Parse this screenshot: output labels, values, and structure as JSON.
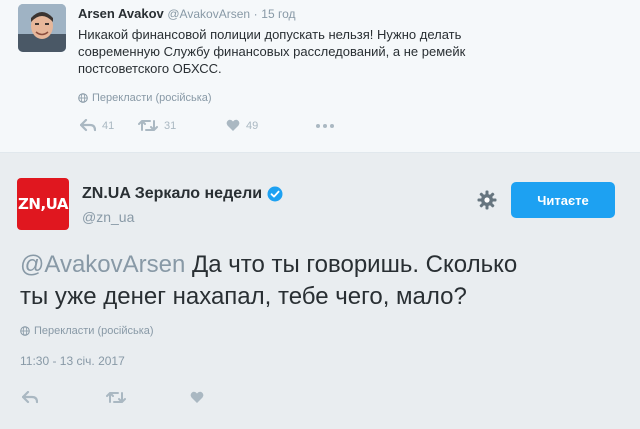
{
  "reply_tweet": {
    "author_name": "Arsen Avakov",
    "handle": "@AvakovArsen",
    "separator": "·",
    "time": "15 год",
    "text_line1": "Никакой финансовой полиции допускать нельзя!  Нужно делать",
    "text_line2": "современную Службу финансовых расследований, а не ремейк",
    "text_line3": "постсоветского ОБХСС.",
    "translate_label": "Перекласти (російська)",
    "reply_count": "41",
    "retweet_count": "31",
    "like_count": "49"
  },
  "main_tweet": {
    "logo_text": "ZN,UA",
    "author_name": "ZN.UA Зеркало недели",
    "handle": "@zn_ua",
    "follow_label": "Читаєте",
    "mention": "@AvakovArsen",
    "text_line1": " Да что ты говоришь. Сколько",
    "text_line2": "ты уже денег нахапал, тебе чего, мало?",
    "translate_label": "Перекласти (російська)",
    "timestamp": "11:30 - 13 січ. 2017"
  },
  "icons": [
    "reply-icon",
    "retweet-icon",
    "like-icon",
    "more-icon",
    "globe-icon",
    "verified-badge-icon",
    "gear-icon"
  ],
  "colors": {
    "accent": "#1da1f2",
    "brand_red": "#e0171f",
    "muted_text": "#8899a6",
    "action_icon": "#aab8c2"
  }
}
